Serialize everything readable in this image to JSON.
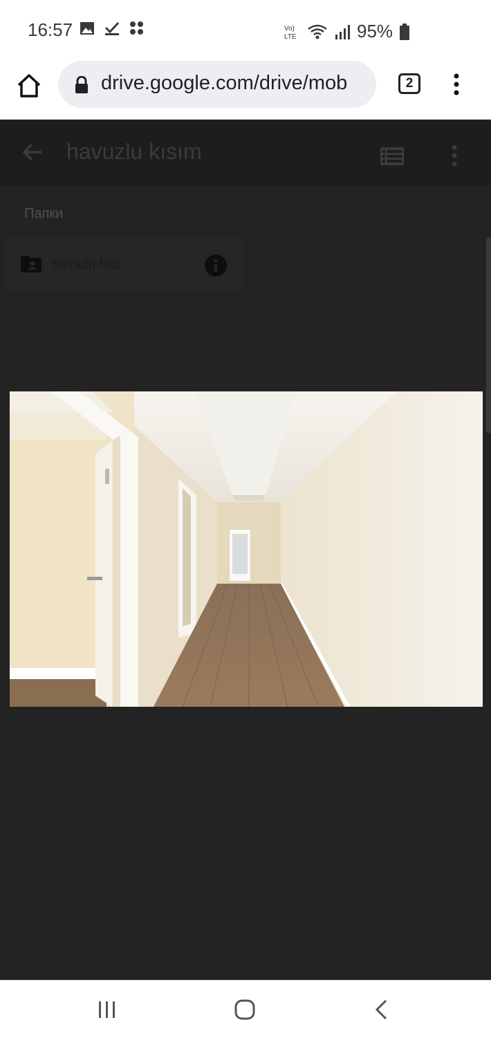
{
  "status_bar": {
    "time": "16:57",
    "battery": "95%",
    "icons": [
      "image-icon",
      "check-download-icon",
      "apps-icon",
      "volte-icon",
      "wifi-icon",
      "signal-icon",
      "battery-icon"
    ]
  },
  "browser": {
    "url": "drive.google.com/drive/mob",
    "tab_count": "2",
    "icons": [
      "home-icon",
      "lock-icon",
      "more-vert-icon"
    ]
  },
  "app_bar": {
    "title": "havuzlu kısım",
    "icons": [
      "arrow-back-icon",
      "list-view-icon",
      "more-vert-icon"
    ]
  },
  "folders": {
    "section_label": "Папки",
    "items": [
      {
        "name": "havadn foto",
        "icon": "shared-folder-icon",
        "action_icon": "info-icon"
      }
    ]
  },
  "photo": {
    "subject": "hallway-photo"
  },
  "nav_bar": {
    "icons": [
      "recents-icon",
      "home-icon",
      "back-icon"
    ]
  },
  "colors": {
    "overlay": "#232323",
    "appbar": "#1d1d1d",
    "statusbar": "#ffffff"
  }
}
